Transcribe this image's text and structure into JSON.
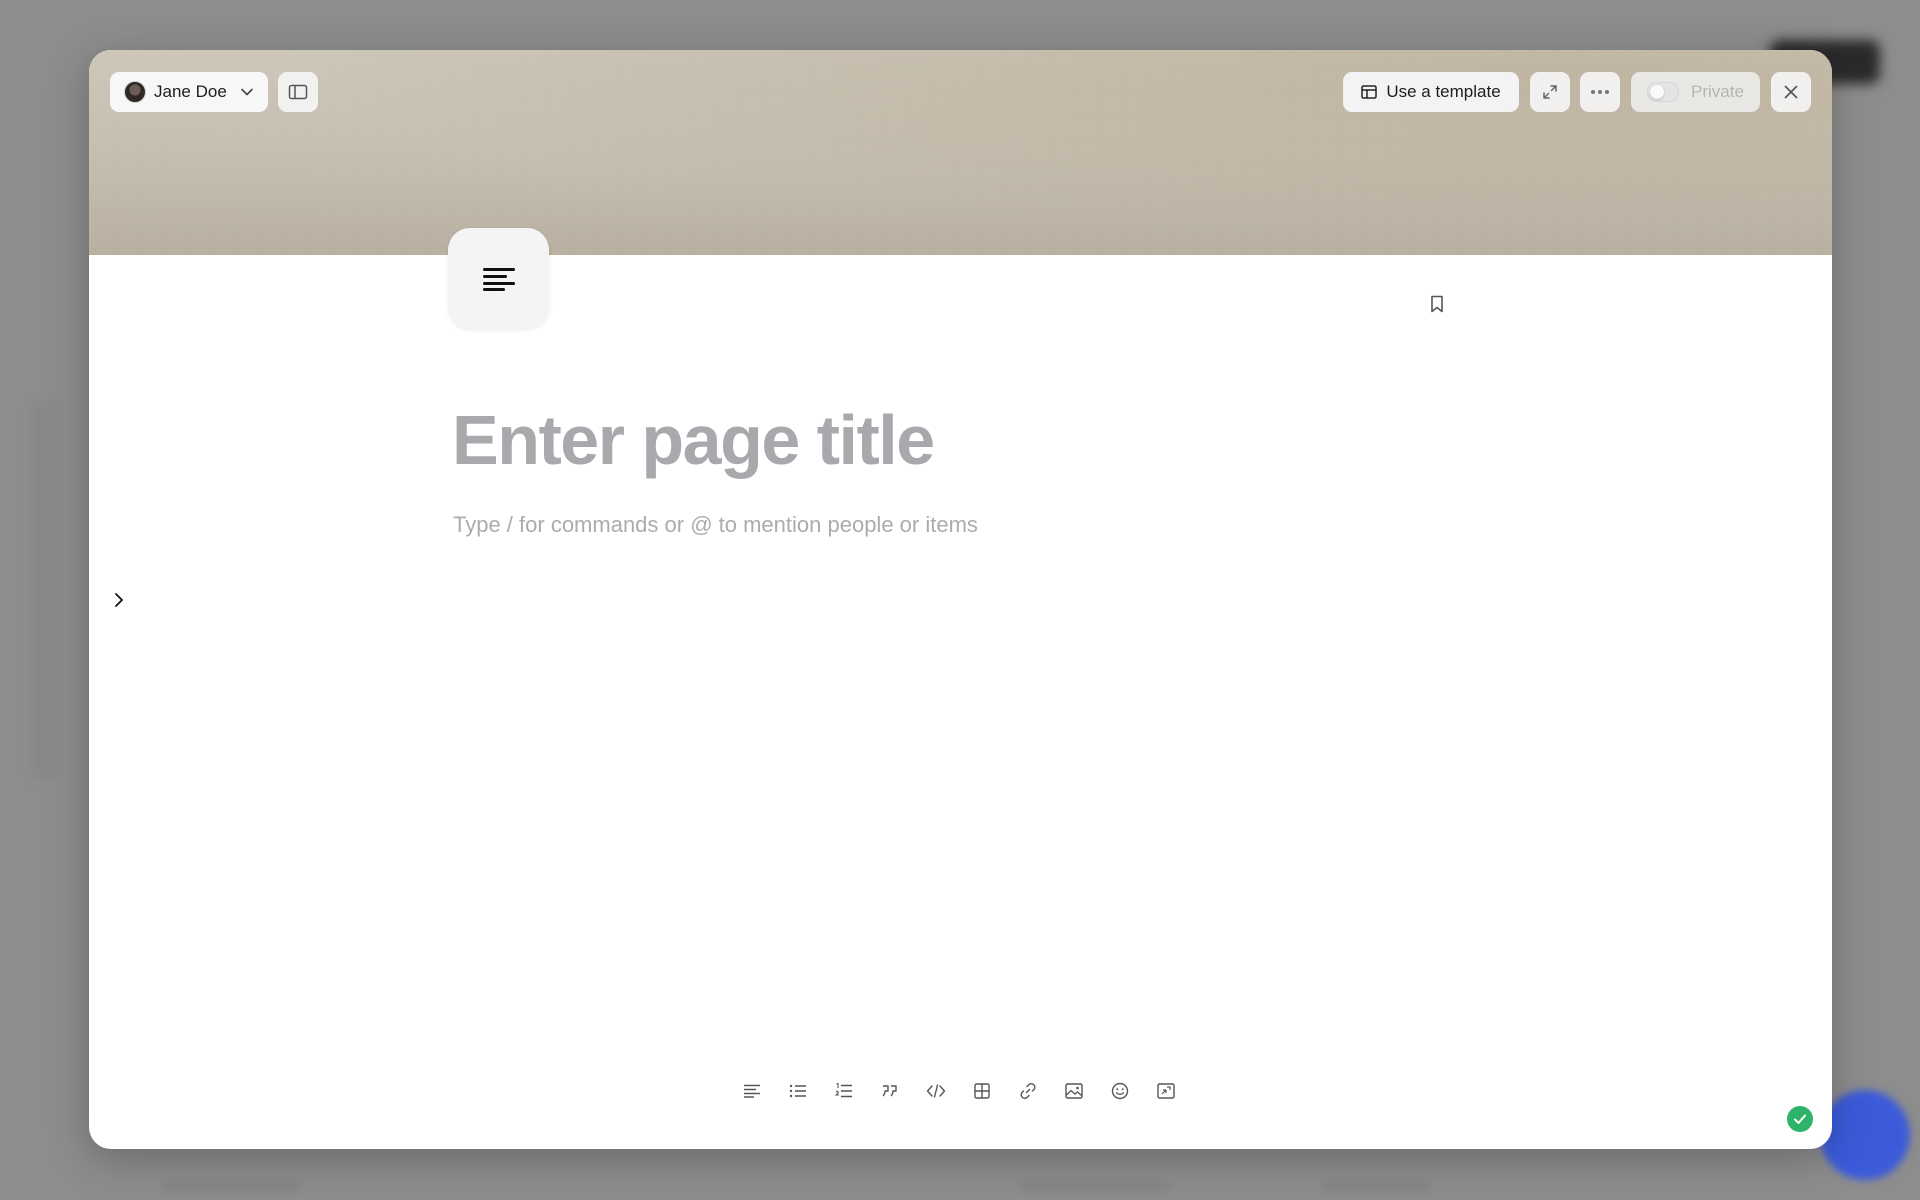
{
  "header": {
    "user_name": "Jane Doe",
    "template_label": "Use a template",
    "private_label": "Private",
    "private_enabled": false
  },
  "editor": {
    "title_placeholder": "Enter page title",
    "body_placeholder": "Type / for commands or @ to mention people or items"
  },
  "toolbar": {
    "items": [
      "paragraph",
      "bulleted-list",
      "numbered-list",
      "quote",
      "code",
      "table",
      "link",
      "image",
      "emoji",
      "embed"
    ]
  },
  "colors": {
    "status_success": "#2fb36b",
    "placeholder_text": "#a8a8ad"
  }
}
